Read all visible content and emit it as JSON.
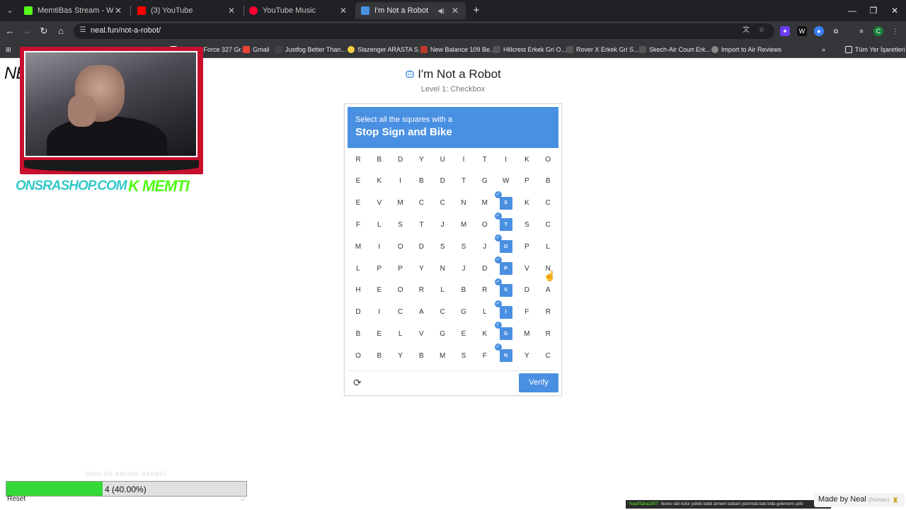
{
  "browser": {
    "tabs": [
      {
        "title": "MemtiBas Stream - Watch Live",
        "favicon_color": "#53fc18",
        "active": false
      },
      {
        "title": "(3) YouTube",
        "favicon_color": "#ff0000",
        "active": false
      },
      {
        "title": "YouTube Music",
        "favicon_color": "#ff0033",
        "active": false
      },
      {
        "title": "I'm Not a Robot",
        "favicon_color": "#4a90e2",
        "active": true
      }
    ],
    "url": "neal.fun/not-a-robot/",
    "bookmarks": [
      {
        "label": "Nike Air Force 327 Gr...",
        "favicon_color": "#ffffff"
      },
      {
        "label": "Gmail",
        "favicon_color": "#ea4335"
      },
      {
        "label": "Justfog Better Than...",
        "favicon_color": "#444444"
      },
      {
        "label": "Slazenger ARASTA S...",
        "favicon_color": "#f4d03f"
      },
      {
        "label": "New Balance 109 Be...",
        "favicon_color": "#c0392b"
      },
      {
        "label": "Hillcrest Erkek Gri O...",
        "favicon_color": "#555555"
      },
      {
        "label": "Rover X Erkek Gri S...",
        "favicon_color": "#555555"
      },
      {
        "label": "Skech-Air Court Erk...",
        "favicon_color": "#555555"
      },
      {
        "label": "Import to Air Reviews",
        "favicon_color": "#888888"
      }
    ],
    "all_bookmarks_label": "Tüm Yer İşaretleri"
  },
  "overlay": {
    "ne_text": "NE",
    "shop_logo": "ONSRASHOP.COM",
    "kick_logo": "K MEMTI",
    "goal": {
      "title": "GÜNLÜK ABONE HEDEFİ",
      "value_text": "4 (40.00%)",
      "fraction": 0.4,
      "reset_label": "Reset",
      "target": "10"
    },
    "chat": {
      "user": "YusufTaha1907:",
      "message": "ikonur abi kufur yokkk bakk annem babam yanımda bak bida gelemem çefe"
    }
  },
  "page": {
    "title": "I'm Not a Robot",
    "level": "Level 1: Checkbox",
    "captcha": {
      "instruction": "Select all the squares with a",
      "target": "Stop Sign and Bike",
      "rows": [
        [
          "R",
          "B",
          "D",
          "Y",
          "U",
          "I",
          "T",
          "I",
          "K",
          "O"
        ],
        [
          "E",
          "K",
          "I",
          "B",
          "D",
          "T",
          "G",
          "W",
          "P",
          "B"
        ],
        [
          "E",
          "V",
          "M",
          "C",
          "C",
          "N",
          "M",
          "S",
          "K",
          "C"
        ],
        [
          "F",
          "L",
          "S",
          "T",
          "J",
          "M",
          "O",
          "T",
          "S",
          "C"
        ],
        [
          "M",
          "I",
          "O",
          "D",
          "S",
          "S",
          "J",
          "O",
          "P",
          "L"
        ],
        [
          "L",
          "P",
          "P",
          "Y",
          "N",
          "J",
          "D",
          "P",
          "V",
          "N"
        ],
        [
          "H",
          "E",
          "O",
          "R",
          "L",
          "B",
          "R",
          "S",
          "D",
          "A"
        ],
        [
          "D",
          "I",
          "C",
          "A",
          "C",
          "G",
          "L",
          "I",
          "F",
          "R"
        ],
        [
          "B",
          "E",
          "L",
          "V",
          "G",
          "E",
          "K",
          "G",
          "M",
          "R"
        ],
        [
          "O",
          "B",
          "Y",
          "B",
          "M",
          "S",
          "F",
          "N",
          "Y",
          "C"
        ]
      ],
      "selected": [
        [
          2,
          7
        ],
        [
          3,
          7
        ],
        [
          4,
          7
        ],
        [
          5,
          7
        ],
        [
          6,
          7
        ],
        [
          7,
          7
        ],
        [
          8,
          7
        ],
        [
          9,
          7
        ]
      ],
      "verify_label": "Verify"
    },
    "made_by": "Made by Neal",
    "made_by_note": "(human)"
  }
}
